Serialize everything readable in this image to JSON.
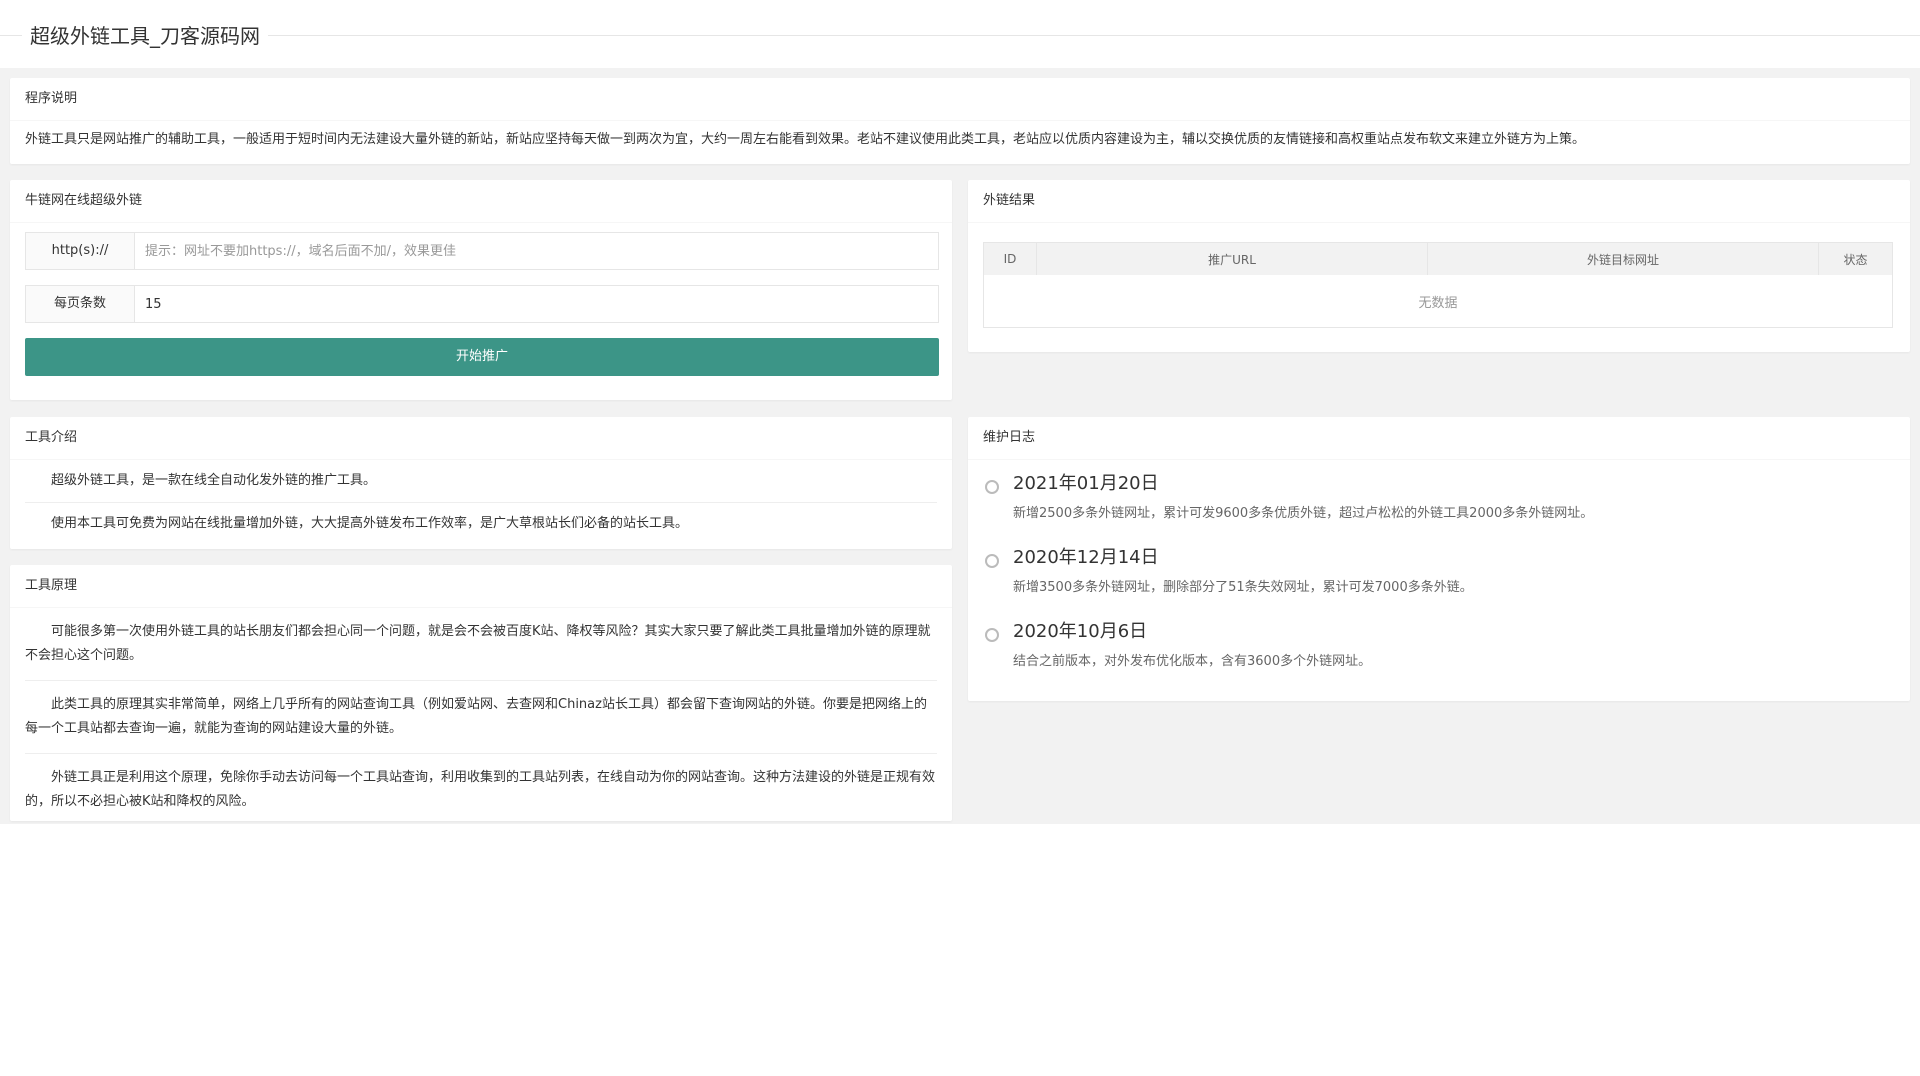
{
  "header": {
    "title": "超级外链工具_刀客源码网"
  },
  "program": {
    "title": "程序说明",
    "text": "外链工具只是网站推广的辅助工具，一般适用于短时间内无法建设大量外链的新站，新站应坚持每天做一到两次为宜，大约一周左右能看到效果。老站不建议使用此类工具，老站应以优质内容建设为主，辅以交换优质的友情链接和高权重站点发布软文来建立外链方为上策。"
  },
  "form": {
    "title": "牛链网在线超级外链",
    "url_label": "http(s)://",
    "url_placeholder": "提示：网址不要加https://，域名后面不加/，效果更佳",
    "count_label": "每页条数",
    "count_value": "15",
    "submit_label": "开始推广"
  },
  "results": {
    "title": "外链结果",
    "columns": [
      "ID",
      "推广URL",
      "外链目标网址",
      "状态"
    ],
    "empty_text": "无数据"
  },
  "intro": {
    "title": "工具介绍",
    "paragraphs": [
      "超级外链工具，是一款在线全自动化发外链的推广工具。",
      "使用本工具可免费为网站在线批量增加外链，大大提高外链发布工作效率，是广大草根站长们必备的站长工具。"
    ]
  },
  "principle": {
    "title": "工具原理",
    "paragraphs": [
      "可能很多第一次使用外链工具的站长朋友们都会担心同一个问题，就是会不会被百度K站、降权等风险？其实大家只要了解此类工具批量增加外链的原理就不会担心这个问题。",
      "此类工具的原理其实非常简单，网络上几乎所有的网站查询工具（例如爱站网、去查网和Chinaz站长工具）都会留下查询网站的外链。你要是把网络上的每一个工具站都去查询一遍，就能为查询的网站建设大量的外链。",
      "外链工具正是利用这个原理，免除你手动去访问每一个工具站查询，利用收集到的工具站列表，在线自动为你的网站查询。这种方法建设的外链是正规有效的，所以不必担心被K站和降权的风险。"
    ]
  },
  "changelog": {
    "title": "维护日志",
    "entries": [
      {
        "date": "2021年01月20日",
        "desc": "新增2500多条外链网址，累计可发9600多条优质外链，超过卢松松的外链工具2000多条外链网址。"
      },
      {
        "date": "2020年12月14日",
        "desc": "新增3500多条外链网址，删除部分了51条失效网址，累计可发7000多条外链。"
      },
      {
        "date": "2020年10月6日",
        "desc": "结合之前版本，对外发布优化版本，含有3600多个外链网址。"
      }
    ]
  },
  "colors": {
    "accent": "#3c9587",
    "background": "#f2f2f2"
  }
}
